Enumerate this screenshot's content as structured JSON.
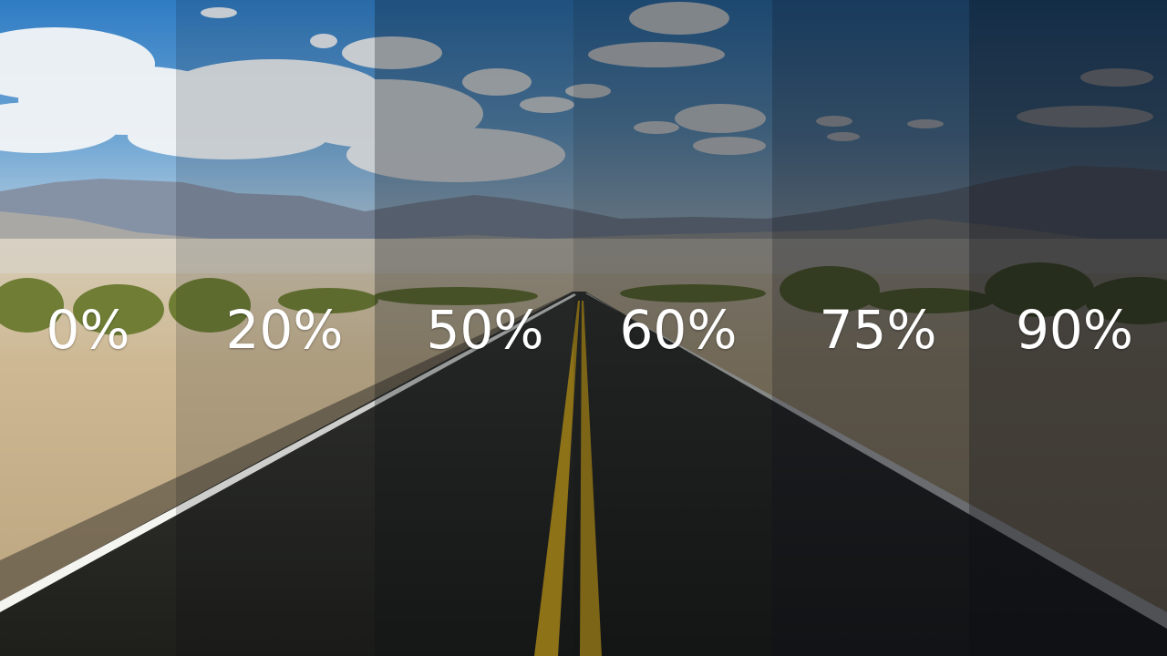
{
  "tint_levels": [
    {
      "label": "0%",
      "darkness": 0.0
    },
    {
      "label": "20%",
      "darkness": 0.2
    },
    {
      "label": "50%",
      "darkness": 0.5
    },
    {
      "label": "60%",
      "darkness": 0.6
    },
    {
      "label": "75%",
      "darkness": 0.75
    },
    {
      "label": "90%",
      "darkness": 0.9
    }
  ],
  "colors": {
    "sky_top": "#3f86c9",
    "sky_horizon": "#a9c6dc",
    "cloud": "#f2f4f6",
    "mountain": "#7d8a9e",
    "desert": "#c9b48e",
    "shrub": "#7b8a3e",
    "road": "#2a2a24",
    "edge_line": "#f4f4f0",
    "center_line": "#e2b21c"
  }
}
